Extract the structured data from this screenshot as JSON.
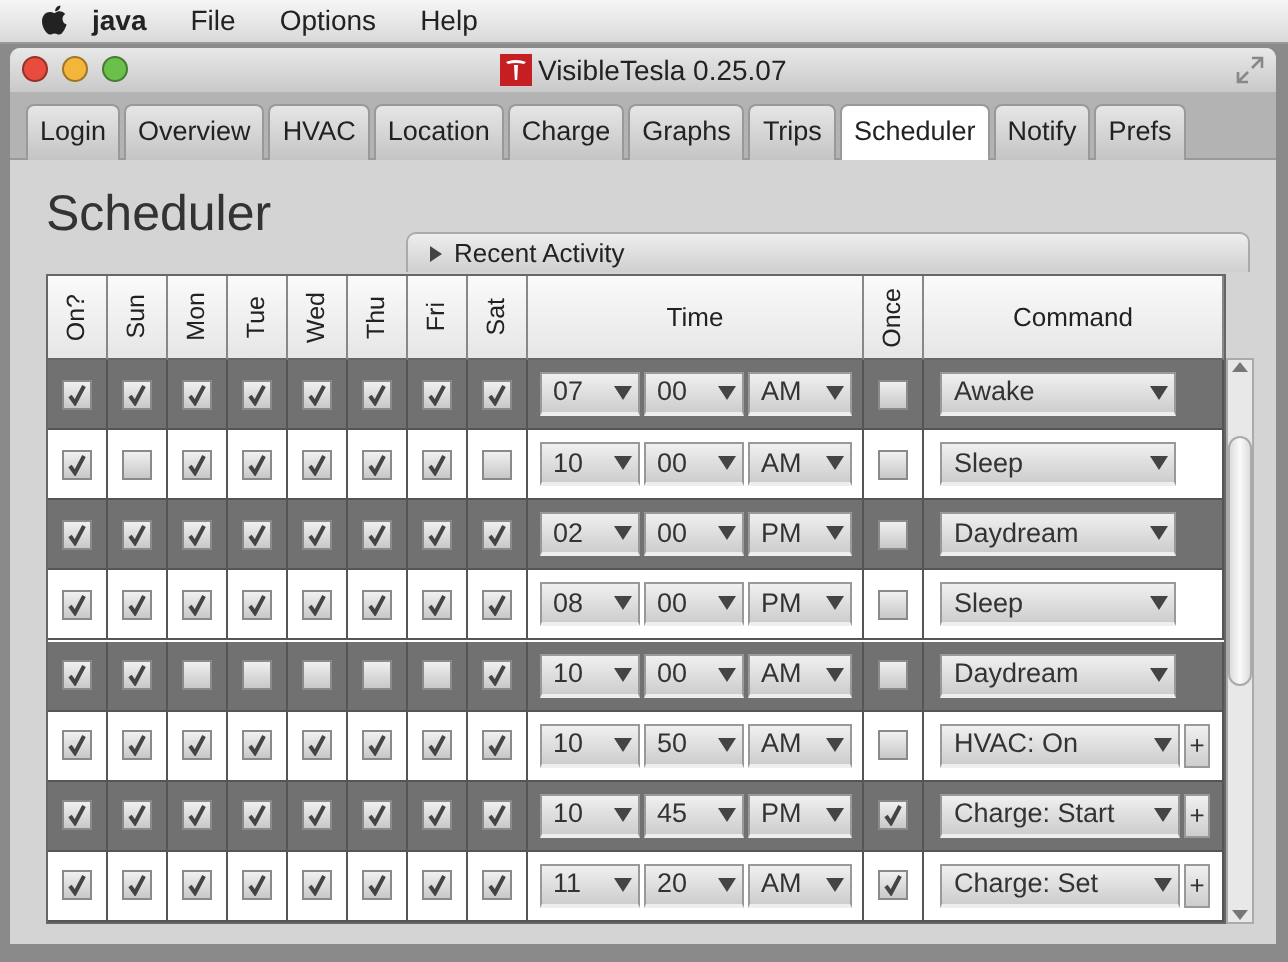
{
  "menu_bar": {
    "items": [
      {
        "label": "java",
        "bold": true
      },
      {
        "label": "File",
        "bold": false
      },
      {
        "label": "Options",
        "bold": false
      },
      {
        "label": "Help",
        "bold": false
      }
    ]
  },
  "window": {
    "title": "VisibleTesla 0.25.07"
  },
  "tabs": [
    {
      "label": "Login",
      "selected": false
    },
    {
      "label": "Overview",
      "selected": false
    },
    {
      "label": "HVAC",
      "selected": false
    },
    {
      "label": "Location",
      "selected": false
    },
    {
      "label": "Charge",
      "selected": false
    },
    {
      "label": "Graphs",
      "selected": false
    },
    {
      "label": "Trips",
      "selected": false
    },
    {
      "label": "Scheduler",
      "selected": true
    },
    {
      "label": "Notify",
      "selected": false
    },
    {
      "label": "Prefs",
      "selected": false
    }
  ],
  "heading": "Scheduler",
  "recent_activity": {
    "label": "Recent Activity",
    "expanded": false
  },
  "table": {
    "columns": {
      "on": "On?",
      "days": [
        "Sun",
        "Mon",
        "Tue",
        "Wed",
        "Thu",
        "Fri",
        "Sat"
      ],
      "time": "Time",
      "once": "Once",
      "command": "Command"
    },
    "rows": [
      {
        "on": true,
        "days": [
          true,
          true,
          true,
          true,
          true,
          true,
          true
        ],
        "hour": "07",
        "minute": "00",
        "ampm": "AM",
        "once": false,
        "command": "Awake"
      },
      {
        "on": true,
        "days": [
          false,
          true,
          true,
          true,
          true,
          true,
          false
        ],
        "hour": "10",
        "minute": "00",
        "ampm": "AM",
        "once": false,
        "command": "Sleep"
      },
      {
        "on": true,
        "days": [
          true,
          true,
          true,
          true,
          true,
          true,
          true
        ],
        "hour": "02",
        "minute": "00",
        "ampm": "PM",
        "once": false,
        "command": "Daydream"
      },
      {
        "on": true,
        "days": [
          true,
          true,
          true,
          true,
          true,
          true,
          true
        ],
        "hour": "08",
        "minute": "00",
        "ampm": "PM",
        "once": false,
        "command": "Sleep"
      },
      {
        "on": true,
        "days": [
          true,
          false,
          false,
          false,
          false,
          false,
          true
        ],
        "hour": "10",
        "minute": "00",
        "ampm": "AM",
        "once": false,
        "command": "Daydream"
      },
      {
        "on": true,
        "days": [
          true,
          true,
          true,
          true,
          true,
          true,
          true
        ],
        "hour": "10",
        "minute": "50",
        "ampm": "AM",
        "once": false,
        "command": "HVAC: On",
        "extra_button": "+"
      },
      {
        "on": true,
        "days": [
          true,
          true,
          true,
          true,
          true,
          true,
          true
        ],
        "hour": "10",
        "minute": "45",
        "ampm": "PM",
        "once": true,
        "command": "Charge: Start",
        "extra_button": "+"
      },
      {
        "on": true,
        "days": [
          true,
          true,
          true,
          true,
          true,
          true,
          true
        ],
        "hour": "11",
        "minute": "20",
        "ampm": "AM",
        "once": true,
        "command": "Charge: Set",
        "extra_button": "+"
      }
    ]
  }
}
